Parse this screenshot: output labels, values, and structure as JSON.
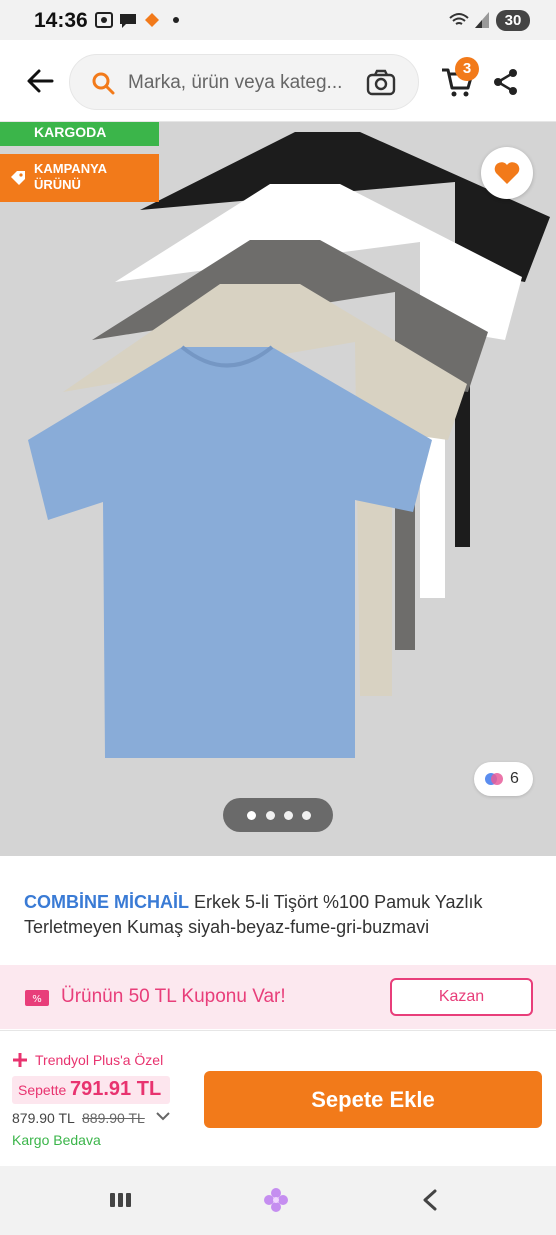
{
  "status_bar": {
    "time": "14:36",
    "battery": "30"
  },
  "header": {
    "search_placeholder": "Marka, ürün veya kateg...",
    "cart_count": "3"
  },
  "gallery": {
    "badges": {
      "kargoda": "KARGODA",
      "kampanya_line1": "KAMPANYA",
      "kampanya_line2": "ÜRÜNÜ"
    },
    "color_count": "6",
    "total_slides": 4,
    "active_slide": 1,
    "shirt_colors": [
      "#1c1c1c",
      "#ffffff",
      "#6e6d6b",
      "#d8d2c2",
      "#89acd8"
    ]
  },
  "product": {
    "brand": "COMBİNE MİCHAİL",
    "title": "Erkek 5-li Tişört %100 Pamuk Yazlık Terletmeyen Kumaş siyah-beyaz-fume-gri-buzmavi"
  },
  "coupon": {
    "text": "Ürünün 50 TL Kuponu Var!",
    "button_label": "Kazan"
  },
  "purchase": {
    "plus_label": "Trendyol Plus'a Özel",
    "basket_label": "Sepette",
    "basket_price": "791.91 TL",
    "current_price": "879.90 TL",
    "old_price": "889.90 TL",
    "free_shipping": "Kargo Bedava",
    "add_to_cart_label": "Sepete Ekle"
  },
  "colors": {
    "accent": "#f27a1a",
    "pink": "#e83e7a",
    "green": "#3bb54a",
    "brand_blue": "#3a7bd5"
  }
}
